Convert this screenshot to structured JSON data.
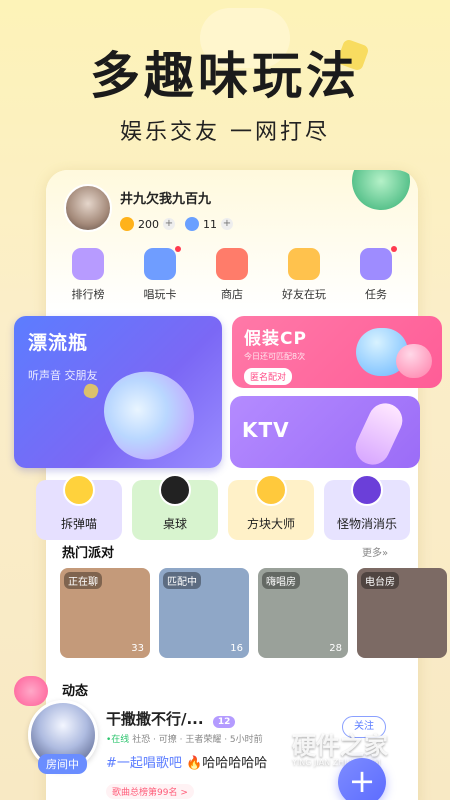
{
  "hero": {
    "title": "多趣味玩法",
    "subtitle": "娱乐交友 一网打尽"
  },
  "profile": {
    "username": "井九欠我九百九",
    "coins": "200",
    "gems": "11",
    "plus": "+"
  },
  "quick_menu": [
    {
      "label": "排行榜",
      "icon": "trophy-icon",
      "color": "#b79bff",
      "dot": false
    },
    {
      "label": "唱玩卡",
      "icon": "sing-card-icon",
      "color": "#6f9dff",
      "dot": true
    },
    {
      "label": "商店",
      "icon": "shop-icon",
      "color": "#ff7c6a",
      "dot": false
    },
    {
      "label": "好友在玩",
      "icon": "friends-playing-icon",
      "color": "#ffc24d",
      "dot": false
    },
    {
      "label": "任务",
      "icon": "task-icon",
      "color": "#9e8cff",
      "dot": true
    }
  ],
  "feature_cards": {
    "drift": {
      "title": "漂流瓶",
      "subtitle": "听声音 交朋友"
    },
    "cp": {
      "title": "假装CP",
      "subtitle": "今日还可匹配8次",
      "button": "匿名配对"
    },
    "ktv": {
      "title": "KTV"
    }
  },
  "games": [
    {
      "label": "拆弹喵",
      "icon": "bomb-cat-icon",
      "bg": "#e6e0ff",
      "icon_color": "#ffd23c"
    },
    {
      "label": "桌球",
      "icon": "billiards-icon",
      "bg": "#d8f4cf",
      "icon_color": "#222222"
    },
    {
      "label": "方块大师",
      "icon": "cube-master-icon",
      "bg": "#fff1c8",
      "icon_color": "#ffc93c"
    },
    {
      "label": "怪物消消乐",
      "icon": "monster-match-icon",
      "bg": "#e7e3ff",
      "icon_color": "#6b3fd9"
    }
  ],
  "party": {
    "title": "热门派对",
    "more": "更多»",
    "rooms": [
      {
        "tag": "正在聊",
        "count": "33",
        "bg": "#c49a7a"
      },
      {
        "tag": "匹配中",
        "count": "16",
        "bg": "#8fa7c7"
      },
      {
        "tag": "嗨唱房",
        "count": "28",
        "bg": "#9aa19a"
      },
      {
        "tag": "电台房",
        "count": "",
        "bg": "#7c6a64"
      }
    ]
  },
  "feed": {
    "title": "动态",
    "room_badge": "房间中",
    "name": "干撒撒不行/...",
    "level": "12",
    "follow": "关注",
    "online": "•在线",
    "meta": "社恐 · 可撩 · 王者荣耀 · 5小时前",
    "hashtag": "#一起唱歌吧",
    "text": "🔥哈哈哈哈哈",
    "rank": "歌曲总榜第99名 >"
  },
  "fab": {
    "label": "+"
  },
  "watermark": {
    "title": "硬件之家",
    "subtitle": "YING JIAN ZHI JIA.COM"
  }
}
